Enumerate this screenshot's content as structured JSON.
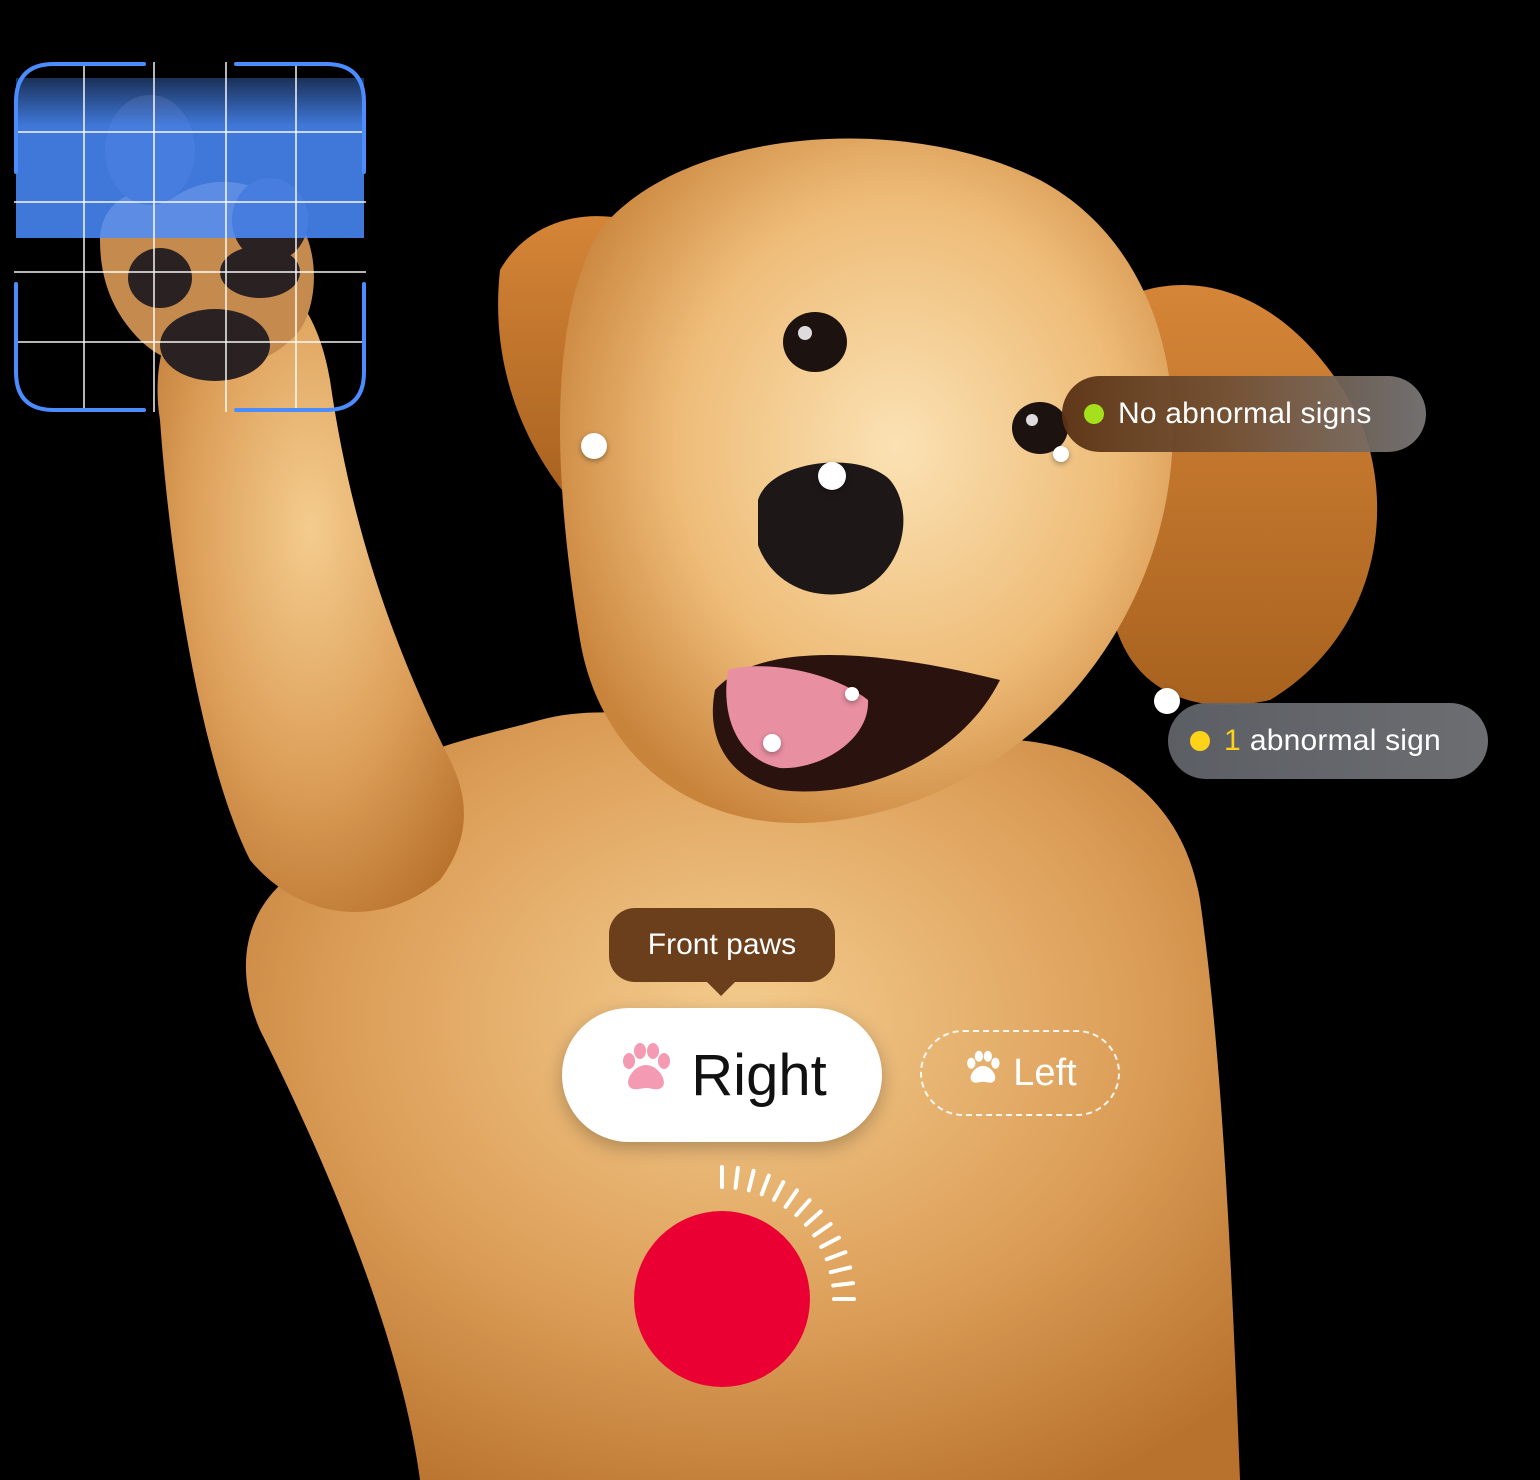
{
  "hotspots": {
    "eye_status": {
      "label": "No abnormal signs",
      "indicator_color": "#a4e01c"
    },
    "ear_status": {
      "count": "1",
      "label": "abnormal sign",
      "indicator_color": "#ffd21a"
    }
  },
  "tooltip": {
    "label": "Front paws"
  },
  "paw_selector": {
    "options": [
      {
        "label": "Right",
        "icon": "paw-icon",
        "selected": true,
        "icon_color": "#f49ab2"
      },
      {
        "label": "Left",
        "icon": "paw-icon",
        "selected": false,
        "icon_color": "#ffffff"
      }
    ]
  },
  "record": {
    "icon": "record-icon",
    "color": "#eb0034",
    "accent": "#4b8dff"
  }
}
